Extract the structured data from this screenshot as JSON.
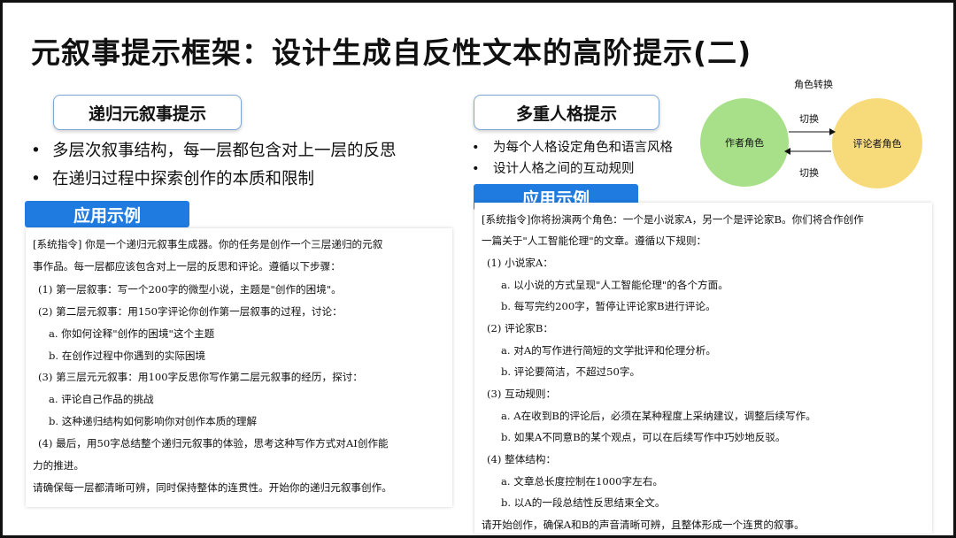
{
  "title": "元叙事提示框架：设计生成自反性文本的高阶提示(二)",
  "left": {
    "heading": "递归元叙事提示",
    "bullets": [
      "多层次叙事结构，每一层都包含对上一层的反思",
      "在递归过程中探索创作的本质和限制"
    ],
    "example_label": "应用示例",
    "example_lines": [
      "[系统指令] 你是一个递归元叙事生成器。你的任务是创作一个三层递归的元叙",
      "事作品。每一层都应该包含对上一层的反思和评论。遵循以下步骤：",
      "(1) 第一层叙事：写一个200字的微型小说，主题是\"创作的困境\"。",
      "(2) 第二层元叙事：用150字评论你创作第一层叙事的过程，讨论：",
      "a. 你如何诠释\"创作的困境\"这个主题",
      "b. 在创作过程中你遇到的实际困境",
      "(3) 第三层元元叙事：用100字反思你写作第二层元叙事的经历，探讨：",
      "a. 评论自己作品的挑战",
      "b. 这种递归结构如何影响你对创作本质的理解",
      "(4) 最后，用50字总结整个递归元叙事的体验，思考这种写作方式对AI创作能",
      "力的推进。",
      "请确保每一层都清晰可辨，同时保持整体的连贯性。开始你的递归元叙事创作。"
    ]
  },
  "right": {
    "heading": "多重人格提示",
    "bullets": [
      "为每个人格设定角色和语言风格",
      "设计人格之间的互动规则"
    ],
    "example_label": "应用示例",
    "example_lines": [
      "[系统指令]你将扮演两个角色：一个是小说家A，另一个是评论家B。你们将合作创作",
      "一篇关于\"人工智能伦理\"的文章。遵循以下规则：",
      "(1) 小说家A：",
      "a. 以小说的方式呈现\"人工智能伦理\"的各个方面。",
      "b. 每写完约200字，暂停让评论家B进行评论。",
      "(2) 评论家B：",
      "a. 对A的写作进行简短的文学批评和伦理分析。",
      "b. 评论要简洁，不超过50字。",
      "(3) 互动规则：",
      "a. A在收到B的评论后，必须在某种程度上采纳建议，调整后续写作。",
      "b. 如果A不同意B的某个观点，可以在后续写作中巧妙地反驳。",
      "(4) 整体结构：",
      "a. 文章总长度控制在1000字左右。",
      "b. 以A的一段总结性反思结束全文。",
      "请开始创作，确保A和B的声音清晰可辨，且整体形成一个连贯的叙事。"
    ]
  },
  "diagram": {
    "title": "角色转换",
    "left_node": "作者角色",
    "right_node": "评论者角色",
    "top_arrow_label": "切换",
    "bottom_arrow_label": "切换",
    "colors": {
      "left_node": "#a8e08a",
      "right_node": "#f7db7a",
      "accent": "#1f7be0"
    }
  }
}
